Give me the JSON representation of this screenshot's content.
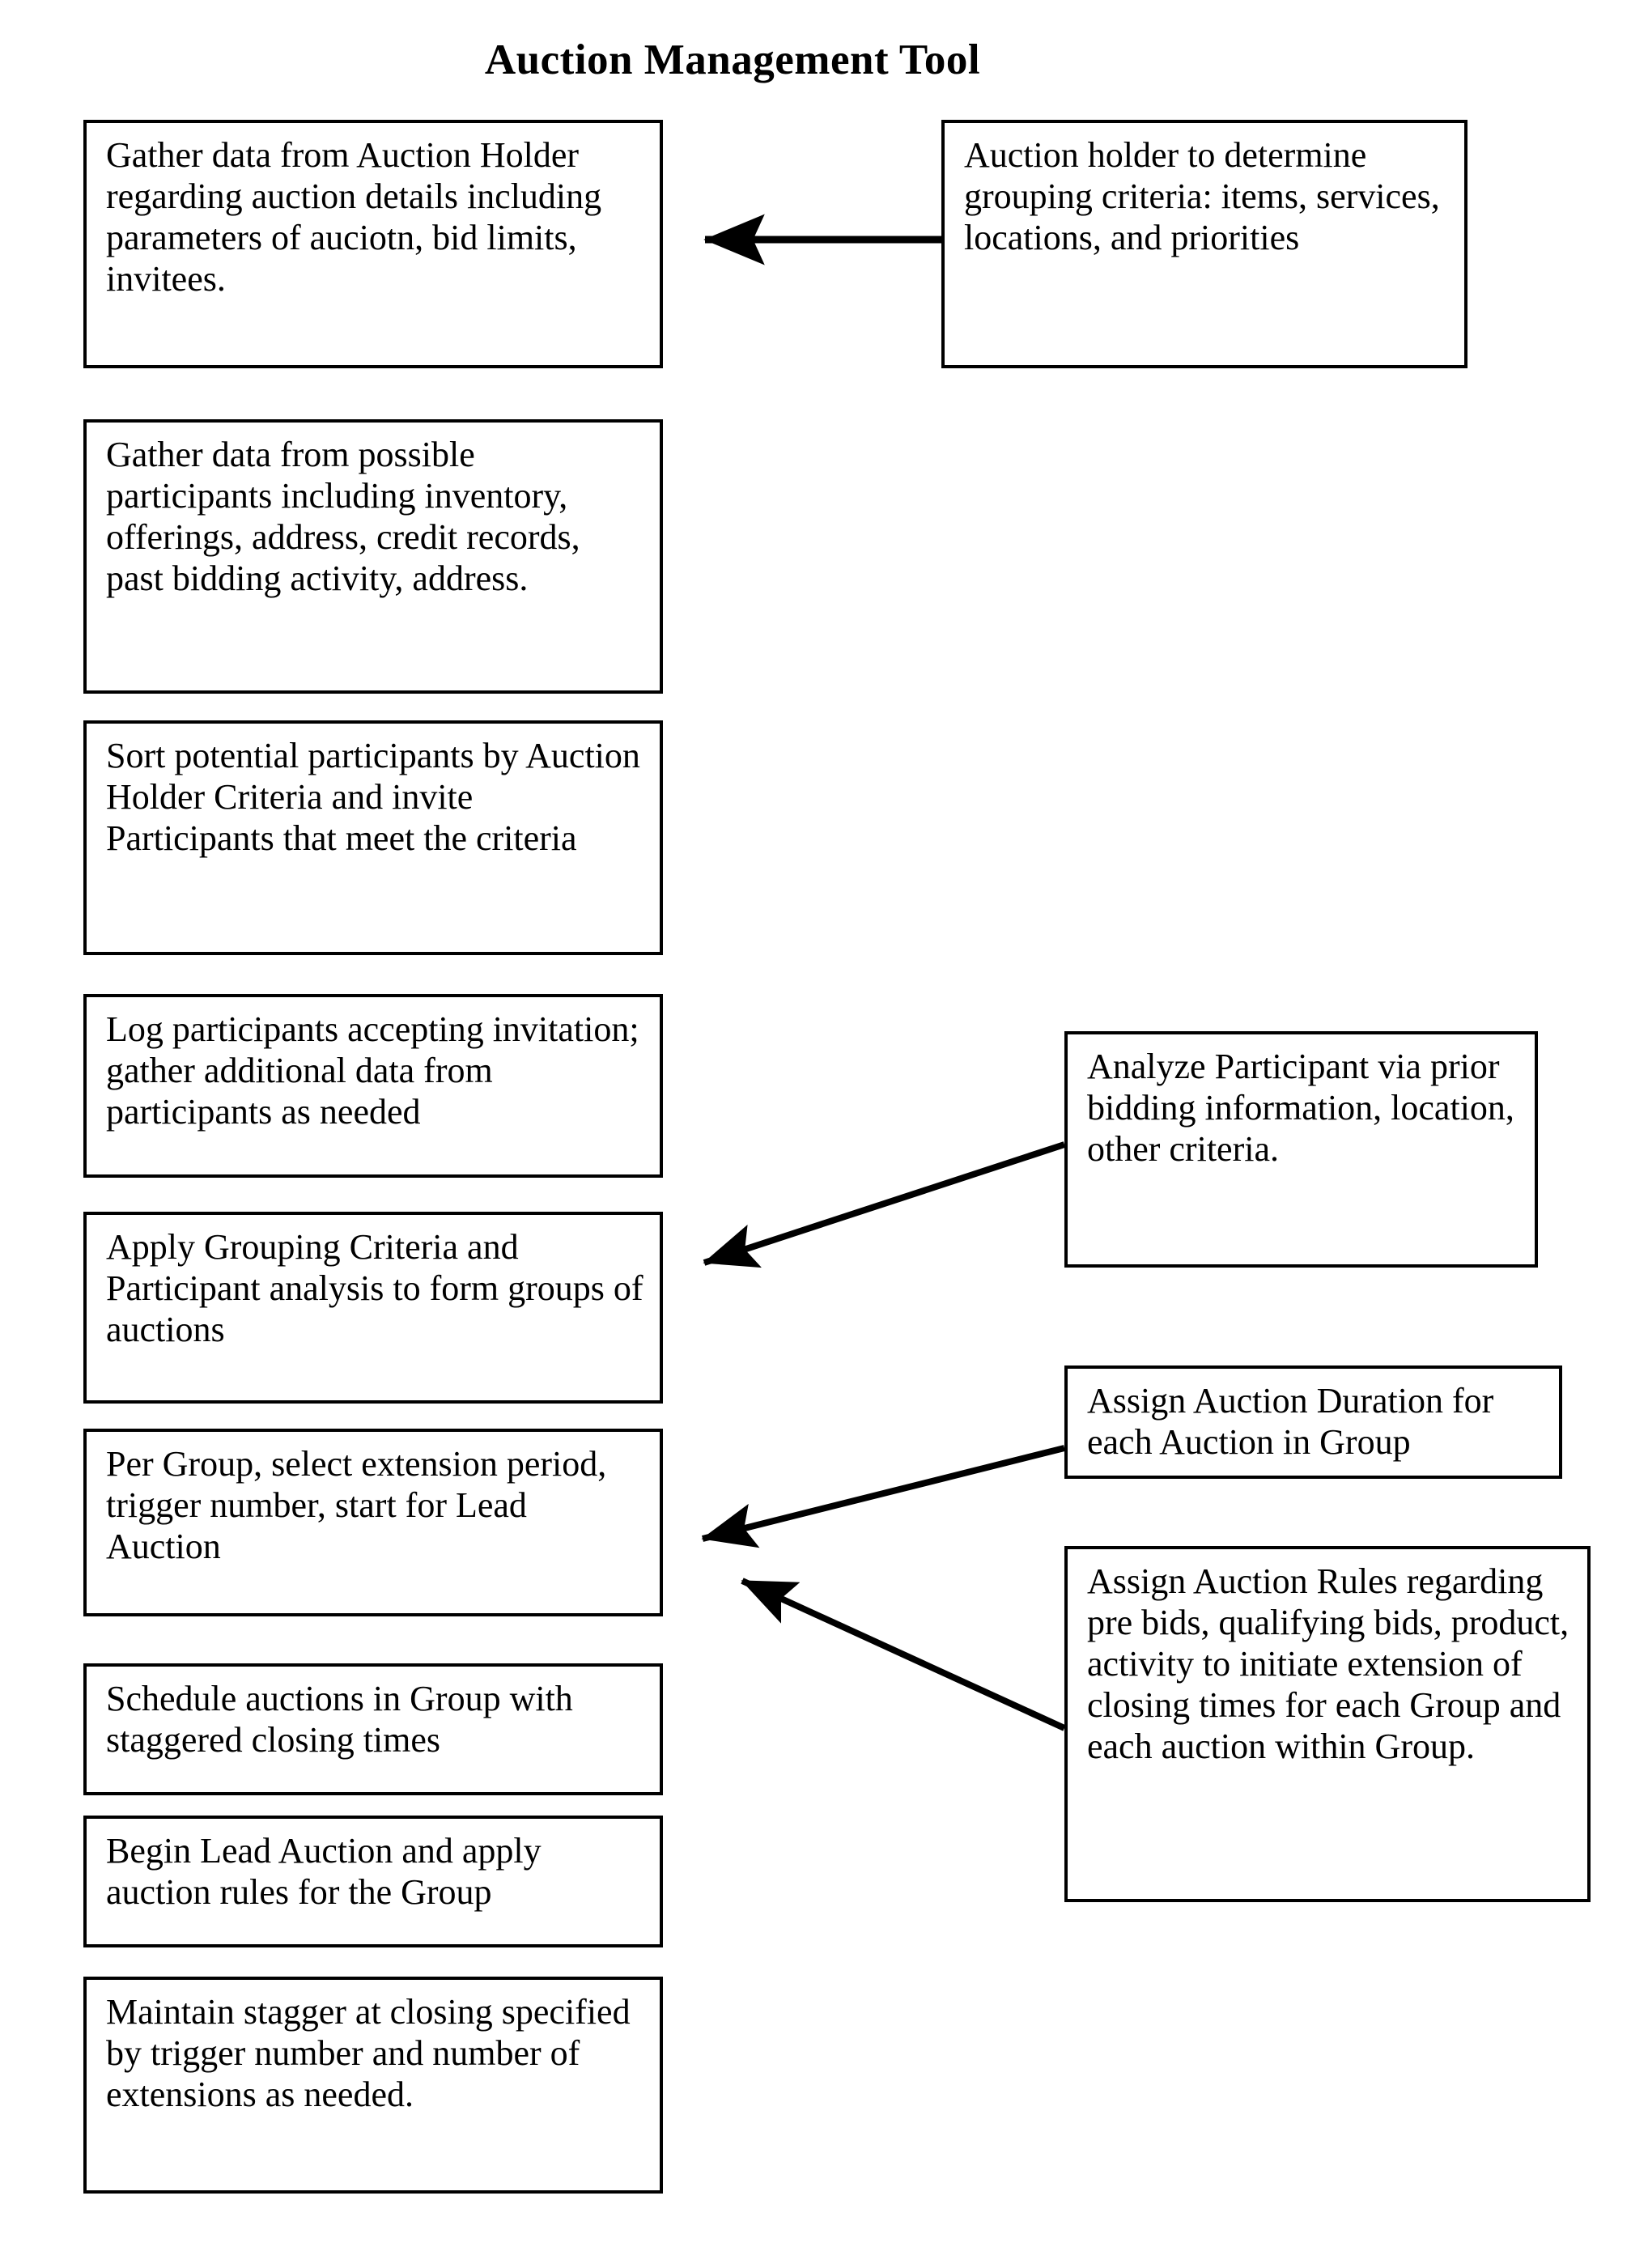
{
  "title": "Auction Management Tool",
  "diagram": {
    "type": "flowchart",
    "orientation": "vertical-left-column-with-right-annotations",
    "stroke_color": "#000000",
    "background_color": "#ffffff",
    "nodes": [
      {
        "id": "gather-auction-holder",
        "column": "left",
        "text": "Gather data from Auction Holder regarding auction details including parameters of auciotn, bid limits, invitees."
      },
      {
        "id": "gather-participants",
        "column": "left",
        "text": "Gather data from possible participants including inventory, offerings, address, credit records, past bidding activity, address."
      },
      {
        "id": "sort-participants",
        "column": "left",
        "text": "Sort potential participants by Auction Holder Criteria and invite Participants that meet the criteria"
      },
      {
        "id": "log-participants",
        "column": "left",
        "text": "Log participants accepting invitation; gather additional data from participants as needed"
      },
      {
        "id": "apply-grouping",
        "column": "left",
        "text": "Apply Grouping Criteria and Participant analysis to form groups of auctions"
      },
      {
        "id": "per-group",
        "column": "left",
        "text": "Per Group, select extension period, trigger number, start for Lead Auction"
      },
      {
        "id": "schedule-auctions",
        "column": "left",
        "text": "Schedule auctions in Group with staggered closing times"
      },
      {
        "id": "begin-lead-auction",
        "column": "left",
        "text": "Begin Lead Auction and apply auction rules for the Group"
      },
      {
        "id": "maintain-stagger",
        "column": "left",
        "text": "Maintain stagger at closing specified by trigger number and number of extensions as needed."
      },
      {
        "id": "grouping-criteria",
        "column": "right",
        "text": "Auction holder to determine grouping criteria: items, services, locations, and priorities"
      },
      {
        "id": "analyze-participant",
        "column": "right",
        "text": "Analyze Participant via prior bidding information, location, other criteria."
      },
      {
        "id": "assign-duration",
        "column": "right",
        "text": "Assign Auction Duration for each Auction in Group"
      },
      {
        "id": "assign-rules",
        "column": "right",
        "text": "Assign Auction Rules regarding pre bids, qualifying bids, product, activity to initiate extension of closing times for each Group and each auction within Group."
      }
    ],
    "connectors": [
      {
        "id": "grouping-criteria-to-gather-auction-holder",
        "from": "grouping-criteria",
        "to": "gather-auction-holder",
        "style": "straight-horizontal-arrow",
        "arrowhead": "left"
      },
      {
        "id": "analyze-participant-to-apply-grouping",
        "from": "analyze-participant",
        "to": "apply-grouping",
        "style": "diagonal-arrow",
        "arrowhead": "down-left"
      },
      {
        "id": "assign-duration-to-per-group",
        "from": "assign-duration",
        "to": "per-group",
        "style": "diagonal-arrow",
        "arrowhead": "down-left"
      },
      {
        "id": "assign-rules-to-per-group",
        "from": "assign-rules",
        "to": "per-group",
        "style": "diagonal-arrow",
        "arrowhead": "up-left"
      }
    ]
  }
}
